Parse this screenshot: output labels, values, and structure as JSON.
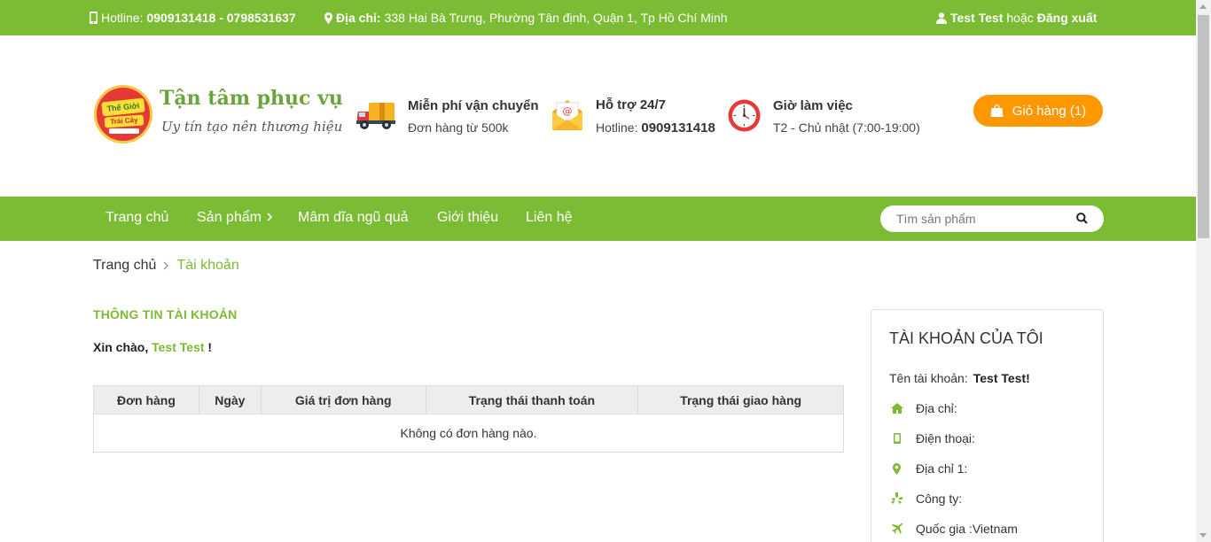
{
  "colors": {
    "brand_green": "#7cbb34",
    "cart_orange": "#ff9800"
  },
  "topbar": {
    "hotline_label": "Hotline:",
    "hotline_value": "0909131418 - 0798531637",
    "address_label": "Địa chỉ:",
    "address_value": "338 Hai Bà Trưng, Phường Tân định, Quận 1, Tp Hồ Chí Minh",
    "user_name": "Test Test",
    "or_text": "hoặc",
    "logout_label": "Đăng xuất",
    "icons": {
      "phone": "mobile-icon",
      "address": "map-marker-icon",
      "user": "user-icon"
    }
  },
  "header": {
    "logo_line1": "Thế Giới",
    "logo_line2": "Trái Cây",
    "slogan_title": "Tận tâm phục vụ",
    "slogan_sub": "Uy tín tạo nên thương hiệu",
    "features": [
      {
        "icon": "delivery-truck-icon",
        "title": "Miễn phí vận chuyển",
        "sub": "Đơn hàng từ 500k"
      },
      {
        "icon": "email-envelope-icon",
        "title": "Hỗ trợ 24/7",
        "sub_label": "Hotline:",
        "sub_value": "0909131418"
      },
      {
        "icon": "clock-icon",
        "title": "Giờ làm việc",
        "sub": "T2 - Chủ nhật (7:00-19:00)"
      }
    ],
    "cart_label": "Giỏ hàng (1)"
  },
  "nav": {
    "items": [
      "Trang chủ",
      "Sản phẩm",
      "Mâm dĩa ngũ quả",
      "Giới thiệu",
      "Liên hệ"
    ],
    "search_placeholder": "Tìm sản phẩm"
  },
  "breadcrumb": {
    "home": "Trang chủ",
    "current": "Tài khoản"
  },
  "account": {
    "heading": "THÔNG TIN TÀI KHOẢN",
    "greeting_prefix": "Xin chào,",
    "greeting_name": "Test Test",
    "greeting_suffix": "!",
    "table": {
      "columns": [
        "Đơn hàng",
        "Ngày",
        "Giá trị đơn hàng",
        "Trạng thái thanh toán",
        "Trạng thái giao hàng"
      ],
      "empty_message": "Không có đơn hàng nào."
    }
  },
  "sidebar": {
    "title": "TÀI KHOẢN CỦA TÔI",
    "account_name_label": "Tên tài khoản:",
    "account_name_value": "Test Test!",
    "rows": [
      {
        "icon": "home-icon",
        "label": "Địa chỉ:"
      },
      {
        "icon": "mobile-icon",
        "label": "Điện thoại:"
      },
      {
        "icon": "map-marker-icon",
        "label": "Địa chỉ 1:"
      },
      {
        "icon": "yelp-icon",
        "label": "Công ty:"
      },
      {
        "icon": "plane-icon",
        "label": "Quốc gia :Vietnam"
      }
    ]
  }
}
